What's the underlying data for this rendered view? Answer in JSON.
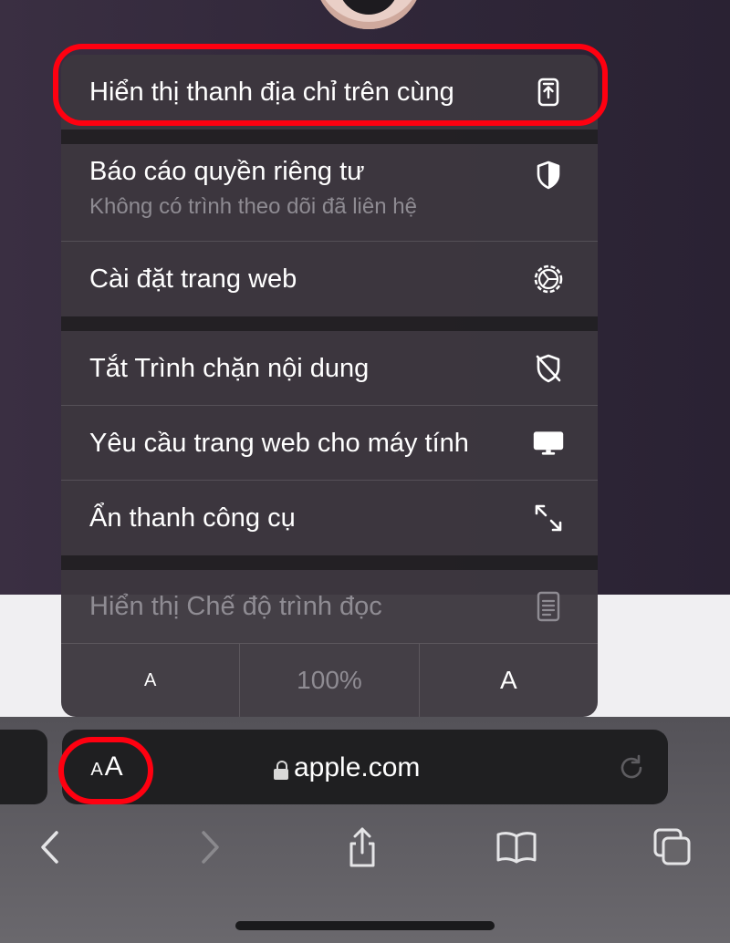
{
  "menu": {
    "show_top_address_bar": "Hiển thị thanh địa chỉ trên cùng",
    "privacy_report": "Báo cáo quyền riêng tư",
    "privacy_report_sub": "Không có trình theo dõi đã liên hệ",
    "website_settings": "Cài đặt trang web",
    "turn_off_content_blockers": "Tắt Trình chặn nội dung",
    "request_desktop_site": "Yêu cầu trang web cho máy tính",
    "hide_toolbar": "Ẩn thanh công cụ",
    "show_reader": "Hiển thị Chế độ trình đọc",
    "zoom": {
      "decrease": "A",
      "level": "100%",
      "increase": "A"
    }
  },
  "address_bar": {
    "format_small": "A",
    "format_big": "A",
    "domain": "apple.com"
  },
  "icons": {
    "top_address_bar": "phone-arrow-up-icon",
    "privacy_report": "shield-half-icon",
    "website_settings": "gear-icon",
    "content_blockers": "shield-slash-icon",
    "desktop": "desktop-icon",
    "hide_toolbar": "expand-arrows-icon",
    "reader": "document-icon",
    "reload": "reload-icon",
    "back": "chevron-left-icon",
    "forward": "chevron-right-icon",
    "share": "share-icon",
    "bookmarks": "book-icon",
    "tabs": "tabs-icon"
  },
  "colors": {
    "highlight_ring": "#ff0010"
  }
}
